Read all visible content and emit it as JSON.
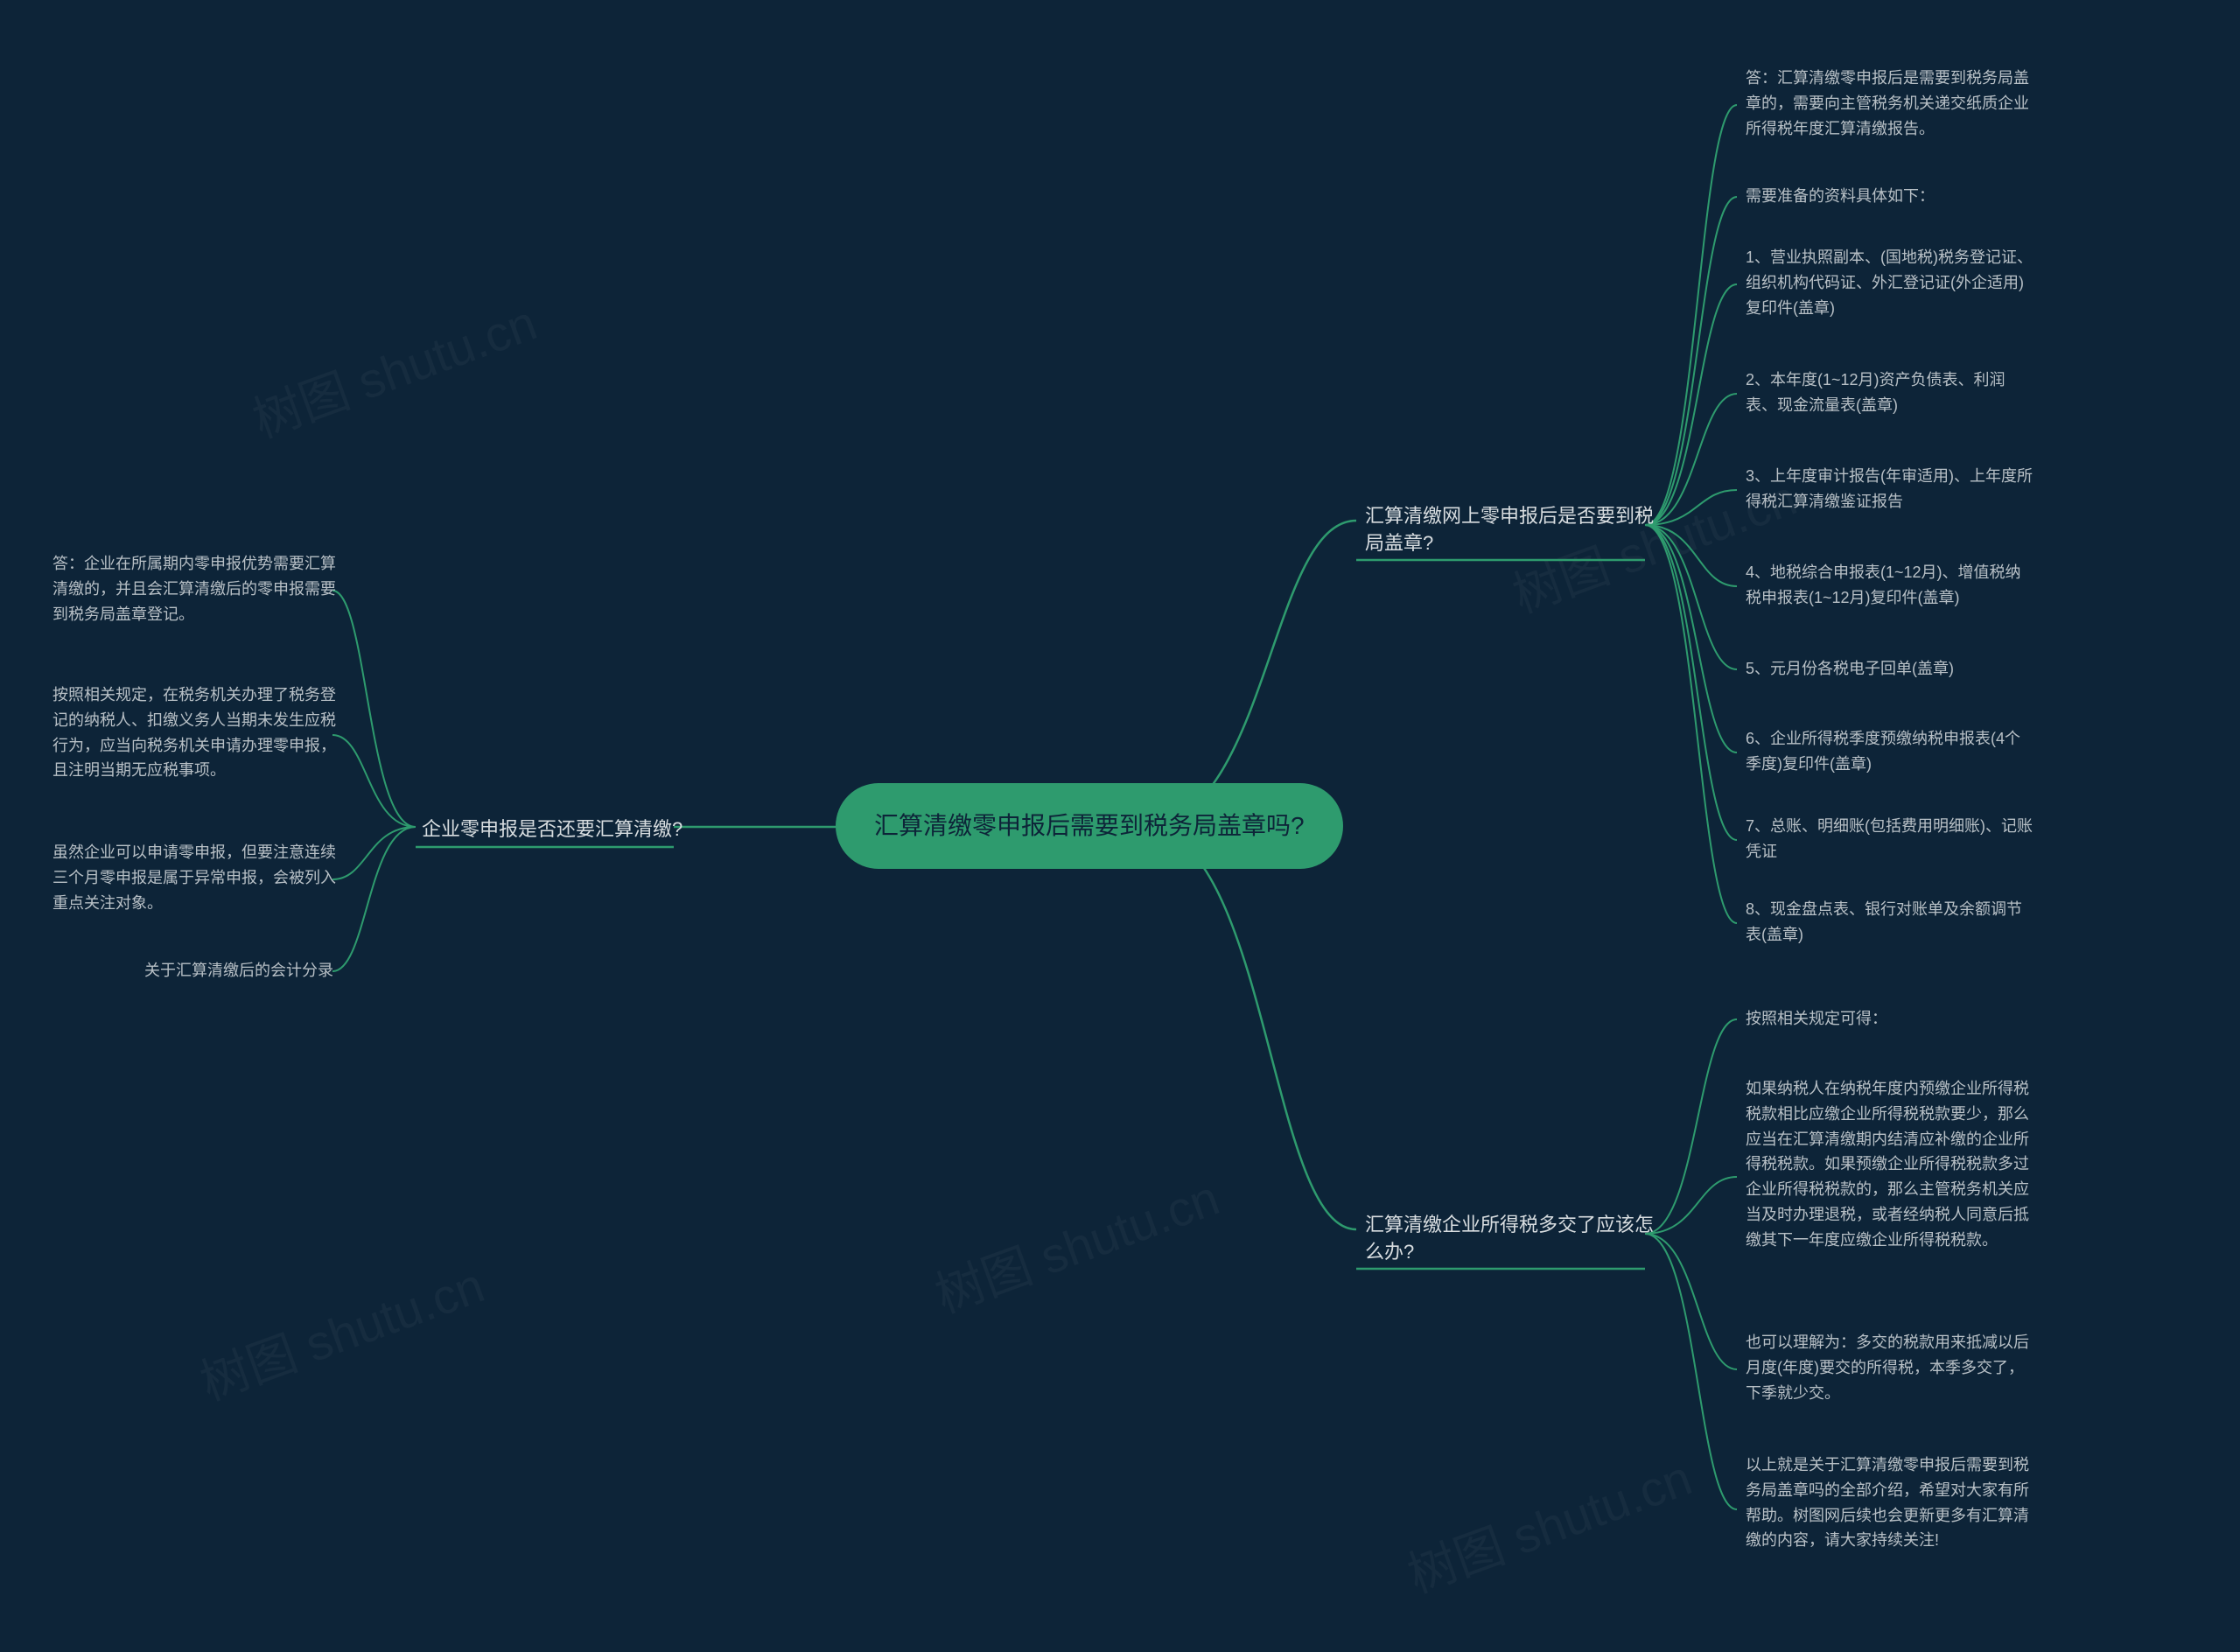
{
  "watermark": "树图 shutu.cn",
  "center": "汇算清缴零申报后需要到税务局盖章吗?",
  "branches": {
    "right1": {
      "label": "汇算清缴网上零申报后是否要到税局盖章?",
      "leaves": [
        "答：汇算清缴零申报后是需要到税务局盖章的，需要向主管税务机关递交纸质企业所得税年度汇算清缴报告。",
        "需要准备的资料具体如下：",
        "1、营业执照副本、(国地税)税务登记证、组织机构代码证、外汇登记证(外企适用)复印件(盖章)",
        "2、本年度(1~12月)资产负债表、利润表、现金流量表(盖章)",
        "3、上年度审计报告(年审适用)、上年度所得税汇算清缴鉴证报告",
        "4、地税综合申报表(1~12月)、增值税纳税申报表(1~12月)复印件(盖章)",
        "5、元月份各税电子回单(盖章)",
        "6、企业所得税季度预缴纳税申报表(4个季度)复印件(盖章)",
        "7、总账、明细账(包括费用明细账)、记账凭证",
        "8、现金盘点表、银行对账单及余额调节表(盖章)"
      ]
    },
    "right2": {
      "label": "汇算清缴企业所得税多交了应该怎么办?",
      "leaves": [
        "按照相关规定可得：",
        "如果纳税人在纳税年度内预缴企业所得税税款相比应缴企业所得税税款要少，那么应当在汇算清缴期内结清应补缴的企业所得税税款。如果预缴企业所得税税款多过企业所得税税款的，那么主管税务机关应当及时办理退税，或者经纳税人同意后抵缴其下一年度应缴企业所得税税款。",
        "也可以理解为：多交的税款用来抵减以后月度(年度)要交的所得税，本季多交了，下季就少交。",
        "以上就是关于汇算清缴零申报后需要到税务局盖章吗的全部介绍，希望对大家有所帮助。树图网后续也会更新更多有汇算清缴的内容，请大家持续关注!"
      ]
    },
    "left1": {
      "label": "企业零申报是否还要汇算清缴?",
      "leaves": [
        "答：企业在所属期内零申报优势需要汇算清缴的，并且会汇算清缴后的零申报需要到税务局盖章登记。",
        "按照相关规定，在税务机关办理了税务登记的纳税人、扣缴义务人当期未发生应税行为，应当向税务机关申请办理零申报，且注明当期无应税事项。",
        "虽然企业可以申请零申报，但要注意连续三个月零申报是属于异常申报，会被列入重点关注对象。",
        "关于汇算清缴后的会计分录"
      ]
    }
  }
}
